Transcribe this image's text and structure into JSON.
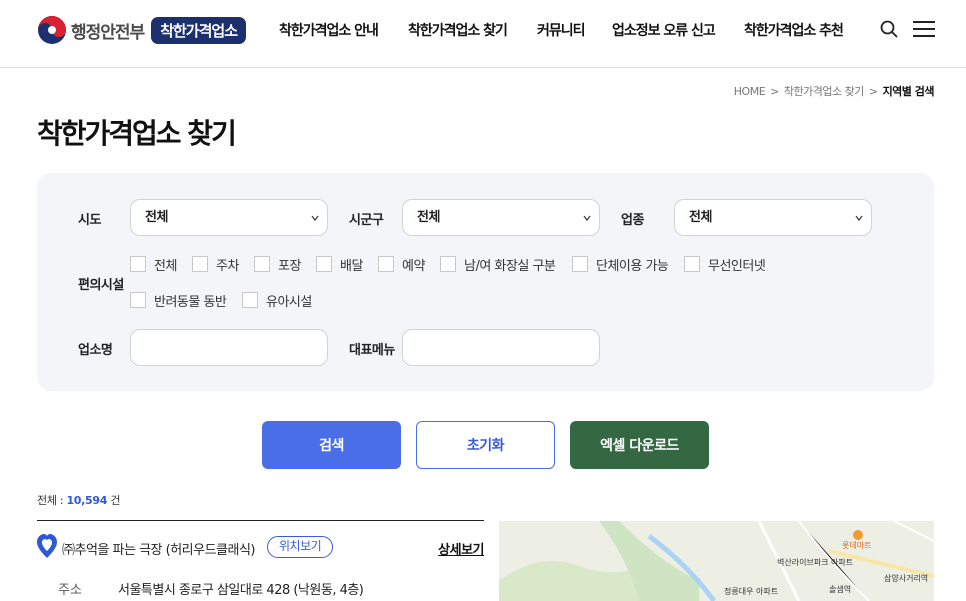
{
  "header": {
    "ministry_name": "행정안전부",
    "brand": "착한가격업소",
    "nav": [
      {
        "label": "착한가격업소 안내"
      },
      {
        "label": "착한가격업소 찾기"
      },
      {
        "label": "커뮤니티"
      },
      {
        "label": "업소정보 오류 신고"
      },
      {
        "label": "착한가격업소 추천"
      }
    ],
    "icons": [
      "search-icon",
      "menu-icon"
    ]
  },
  "breadcrumb": {
    "items": [
      "HOME",
      "착한가격업소 찾기",
      "지역별 검색"
    ],
    "separator": ">"
  },
  "page_title": "착한가격업소 찾기",
  "search": {
    "sido_label": "시도",
    "sido_value": "전체",
    "sigungu_label": "시군구",
    "sigungu_value": "전체",
    "category_label": "업종",
    "category_value": "전체",
    "amenities_label": "편의시설",
    "amenities": [
      "전체",
      "주차",
      "포장",
      "배달",
      "예약",
      "남/여 화장실 구분",
      "단체이용 가능",
      "무선인터넷",
      "반려동물 동반",
      "유아시설"
    ],
    "store_name_label": "업소명",
    "store_name_value": "",
    "menu_label": "대표메뉴",
    "menu_value": ""
  },
  "buttons": {
    "search": "검색",
    "reset": "초기화",
    "excel": "엑셀 다운로드"
  },
  "total": {
    "prefix": "전체 :",
    "count": "10,594",
    "unit": "건"
  },
  "results": [
    {
      "name": "㈜추억을 파는 극장 (허리우드클래식)",
      "location_button": "위치보기",
      "detail_link": "상세보기",
      "address_label": "주소",
      "address": "서울특별시 종로구 삼일대로 428 (낙원동, 4층)"
    }
  ],
  "map": {
    "labels": [
      "롯데마트",
      "벽산라이브파크 아파트",
      "삼양사거리역",
      "정릉대우 아파트",
      "솔샘역"
    ]
  },
  "colors": {
    "brand_navy": "#1c2f6e",
    "primary_blue": "#4a6ee8",
    "excel_green": "#336842",
    "panel_bg": "#f4f5f8"
  }
}
